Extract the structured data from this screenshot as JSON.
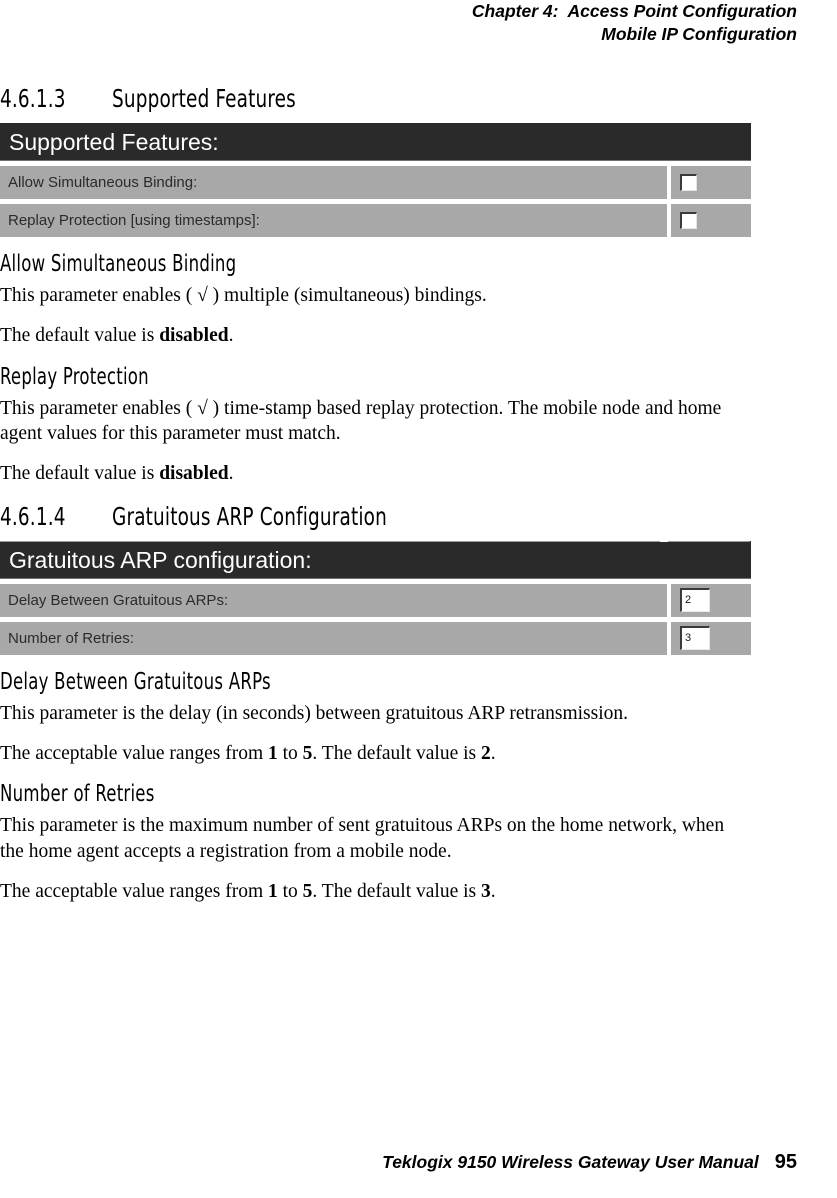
{
  "running_head": {
    "line1": "Chapter 4:  Access Point Configuration",
    "line2": "Mobile IP Configuration"
  },
  "sections": {
    "supported_features": {
      "number": "4.6.1.3",
      "title": "Supported Features"
    },
    "gratuitous_arp": {
      "number": "4.6.1.4",
      "title": "Gratuitous ARP Configuration"
    }
  },
  "panels": {
    "supported_features": {
      "title": "Supported Features:",
      "rows": [
        {
          "label": "Allow Simultaneous Binding:",
          "control": "checkbox",
          "checked": false
        },
        {
          "label": "Replay Protection [using timestamps]:",
          "control": "checkbox",
          "checked": false
        }
      ]
    },
    "gratuitous_arp": {
      "title": "Gratuitous ARP configuration:",
      "rows": [
        {
          "label": "Delay Between Gratuitous ARPs:",
          "control": "textinput",
          "value": "2"
        },
        {
          "label": "Number of Retries:",
          "control": "textinput",
          "value": "3"
        }
      ]
    }
  },
  "subsections": {
    "allow_simultaneous_binding": {
      "heading": "Allow Simultaneous Binding",
      "para1": "This parameter enables ( √ ) multiple (simultaneous) bindings.",
      "para2_prefix": "The default value is ",
      "para2_strong": "disabled",
      "para2_suffix": "."
    },
    "replay_protection": {
      "heading": "Replay Protection",
      "para1": "This parameter enables ( √ ) time-stamp based replay protection. The mobile node and home agent values for this parameter must match.",
      "para2_prefix": "The default value is ",
      "para2_strong": "disabled",
      "para2_suffix": "."
    },
    "delay_between_gratuitous_arps": {
      "heading": "Delay Between Gratuitous ARPs",
      "para1": "This parameter is the delay (in seconds) between gratuitous ARP retransmission.",
      "para2_a": "The acceptable value ranges from ",
      "para2_min": "1",
      "para2_b": " to ",
      "para2_max": "5",
      "para2_c": ". The default value is ",
      "para2_default": "2",
      "para2_d": "."
    },
    "number_of_retries": {
      "heading": "Number of Retries",
      "para1": "This parameter is the maximum number of sent gratuitous ARPs on the home network, when the home agent accepts a registration from a mobile node.",
      "para2_a": "The acceptable value ranges from ",
      "para2_min": "1",
      "para2_b": " to ",
      "para2_max": "5",
      "para2_c": ". The default value is ",
      "para2_default": "3",
      "para2_d": "."
    }
  },
  "footer": {
    "manual_title": "Teklogix 9150 Wireless Gateway User Manual",
    "page_number": "95"
  },
  "colors": {
    "panel_header_bg": "#2a2a2a",
    "panel_row_bg": "#a8a8a8",
    "page_bg": "#ffffff",
    "text": "#000000"
  }
}
